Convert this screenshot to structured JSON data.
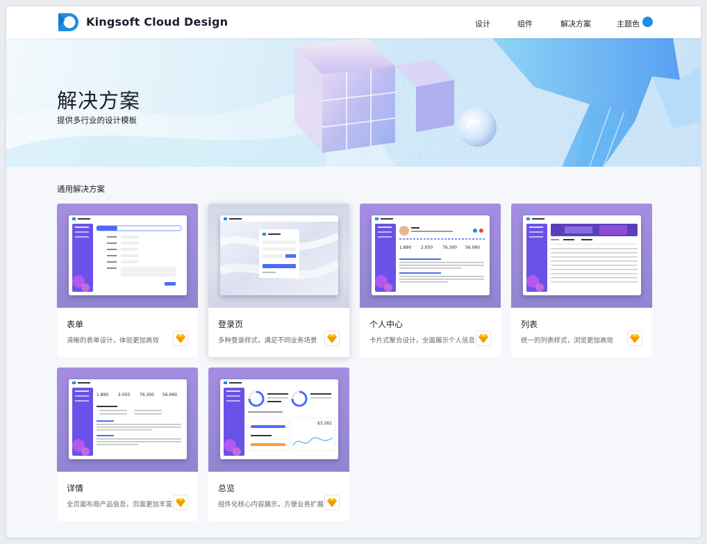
{
  "header": {
    "brand": "Kingsoft Cloud Design",
    "nav": [
      "设计",
      "组件",
      "解决方案",
      "主题色"
    ],
    "theme_color": "#1b8fe3"
  },
  "hero": {
    "title": "解决方案",
    "subtitle": "提供多行业的设计模板"
  },
  "section": {
    "title": "通用解决方案"
  },
  "cards": [
    {
      "title": "表单",
      "desc": "清晰的表单设计，体验更加高效"
    },
    {
      "title": "登录页",
      "desc": "多种登录样式，满足不同业务场景"
    },
    {
      "title": "个人中心",
      "desc": "卡片式聚合设计，全面展示个人信息"
    },
    {
      "title": "列表",
      "desc": "统一的列表样式，浏览更加高效"
    },
    {
      "title": "详情",
      "desc": "全页面布局产品信息，页面更加丰富"
    },
    {
      "title": "总览",
      "desc": "组件化核心内容展示，方便业务扩展"
    }
  ],
  "colors": {
    "accent": "#1b8fe3",
    "card_header": "#a48de0",
    "sketch_icon": "#f7b500"
  },
  "icons": {
    "logo": "kingsoft-logo-icon",
    "sketch": "sketch-diamond-icon"
  }
}
